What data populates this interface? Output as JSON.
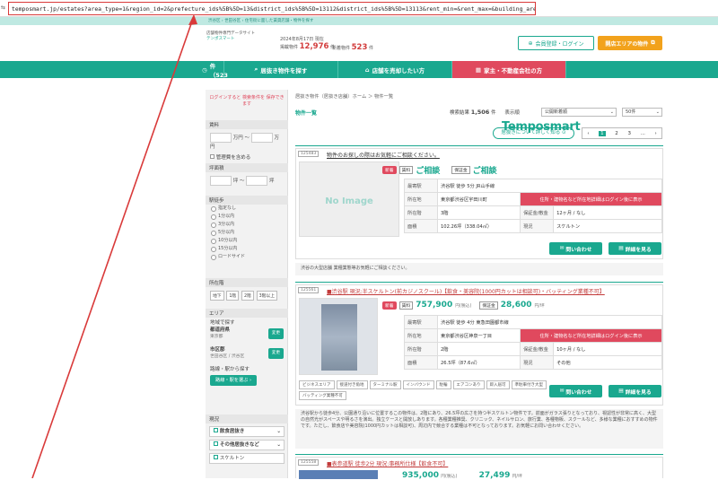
{
  "browser": {
    "url": "temposmart.jp/estates?area_type=1&region_id=2&prefecture_ids%5B%5D=13&district_ids%5B%5D=13112&district_ids%5B%5D=13113&rent_min=&rent_max=&building_area_min=&building_area_max="
  },
  "topbar_text": "渋谷区 › 世田谷区 › 住宅街に面した賃貸店舗・物件を探す",
  "header": {
    "logo_sub": "店舗物件専門データサイト",
    "logo_main": "Temposmart",
    "logo_kana": "テンポスマート",
    "stat_date": "2024年8月17日 現在",
    "stat1_label": "掲載物件",
    "stat1_value": "12,976",
    "stat1_unit": "件",
    "stat2_label": "新着物件",
    "stat2_value": "523",
    "stat2_unit": "件",
    "login_button": "会員登録・ログイン",
    "area_button": "開店エリアの物件"
  },
  "nav": [
    {
      "label": "新着物件（523件）"
    },
    {
      "label": "居抜き物件を探す"
    },
    {
      "label": "店舗を売却したい方"
    },
    {
      "label": "家主・不動産会社の方"
    }
  ],
  "sidebar": {
    "login_note": "ログインすると 検索条件を 保存できます",
    "rent_title": "賃料",
    "rent_from_unit": "万円 〜",
    "rent_to_unit": "万円",
    "include_mgmt": "管理費を含める",
    "area_title": "坪面積",
    "area_from_unit": "坪 〜",
    "area_to_unit": "坪",
    "walk_title": "駅徒歩",
    "walk_options": [
      "指定なし",
      "1分以内",
      "3分以内",
      "5分以内",
      "10分以内",
      "15分以内",
      "ロードサイド"
    ],
    "floor_title": "所在階",
    "floor_options": [
      "地下",
      "1階",
      "2階",
      "3階以上"
    ],
    "area_section_title": "エリア",
    "area_pick": "地域で探す",
    "pref_label": "都道府県",
    "pref_value": "東京都",
    "change_label": "変更",
    "city_label": "市区郡",
    "city_value": "世田谷区 / 渋谷区",
    "line_pick": "路線・駅から探す",
    "line_button": "路線・駅を選ぶ",
    "current_title": "現況",
    "current_options": [
      "飲食居抜き",
      "その他居抜きなど",
      "スケルトン"
    ]
  },
  "main": {
    "breadcrumb": "居抜き物件（居抜き店舗）ホーム ＞ 物件一覧",
    "list_heading": "物件一覧",
    "result_label": "検索結果",
    "result_count": "1,506",
    "result_unit": "件",
    "display_label": "表示順",
    "sort_value": "公開新着順",
    "per_page_value": "50件",
    "about_button": "居抜きについて詳しく知る",
    "pager": [
      "‹",
      "1",
      "2",
      "3",
      "...",
      "›"
    ]
  },
  "listings": [
    {
      "id": "125483",
      "title": "物件のお探しの際はお気軽にご相談ください。",
      "badge_new": "新着",
      "rent_label": "賃料",
      "price": "ご相談",
      "deposit_label": "保証金",
      "deposit": "ご相談",
      "no_image": "No Image",
      "spec": {
        "station_h": "最寄駅",
        "station": "渋谷駅 徒歩 5分 JR山手線",
        "addr_h": "所在地",
        "addr": "東京都渋谷区宇田川町",
        "warn": "住所・建物名など所在地詳細はログイン後に表示",
        "floor_h": "所在階",
        "floor": "3階",
        "lease_h": "保証金/敷金",
        "lease": "12ヶ月 / なし",
        "area_h": "面積",
        "area": "102.26坪（338.04㎡）",
        "status_h": "現況",
        "status": "スケルトン"
      },
      "contact_button": "問い合わせ",
      "detail_button": "詳細を見る",
      "comment": "渋谷の大型店舗 業種業態等お気軽にご相談ください。"
    },
    {
      "id": "125561",
      "title": "■渋谷駅 現況:半スケルトン(前カジノスクール)【飲食・美容院(1000円カットは相談可)・バッティング業種不可】",
      "badge_new": "新着",
      "rent_label": "賃料",
      "price": "757,900",
      "price_unit": "円(税込)",
      "deposit_label": "保証金",
      "deposit": "28,600",
      "deposit_unit": "円/坪",
      "spec": {
        "station_h": "最寄駅",
        "station": "渋谷駅 徒歩 4分 東急田園都市線",
        "addr_h": "所在地",
        "addr": "東京都渋谷区神泉一丁目",
        "warn": "住所・建物名など所在地詳細はログイン後に表示",
        "floor_h": "所在階",
        "floor": "2階",
        "lease_h": "保証金/敷金",
        "lease": "10ヶ月 / なし",
        "area_h": "面積",
        "area": "26.5坪（87.6㎡）",
        "status_h": "現況",
        "status": "その他"
      },
      "tags": [
        "ビジネスエリア",
        "接道付き角地",
        "ターミナル駅",
        "インバウンド",
        "駐輪",
        "エアコンあり",
        "即入居可",
        "準駐車付き大型",
        "バッティング業種不可"
      ],
      "contact_button": "問い合わせ",
      "detail_button": "詳細を見る",
      "comment": "渋谷駅から徒歩4分、公園通り沿いに位置するこの物件は、2階にあり、26.5坪の広さを持つ半スケルトン物件です。前面がガラス張りとなっており、視認性が非常に高く、大型の自然光がスペースや明るさを演出。独立ケースと開放しあります。各種業種推奨、クリニック、ネイルサロン、旅行業、各種物販、スクールなど、多様な業種におすすめの物件です。ただし、飲食店や美容院(1000円カットは相談可)、周辺内で競合する業種は不可となっております。お気軽にお問い合わせください。"
    },
    {
      "id": "125558",
      "title": "■表参道駅 徒歩2分 現況:事務所仕様【飲食不可】",
      "price": "935,000",
      "price_unit": "円(税込)",
      "deposit": "27,499",
      "deposit_unit": "円/坪"
    }
  ]
}
